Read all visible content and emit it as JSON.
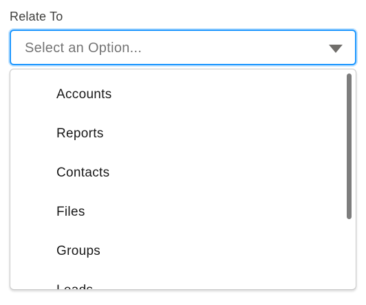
{
  "field": {
    "label": "Relate To",
    "placeholder": "Select an Option..."
  },
  "dropdown": {
    "options": [
      {
        "label": "Accounts"
      },
      {
        "label": "Reports"
      },
      {
        "label": "Contacts"
      },
      {
        "label": "Files"
      },
      {
        "label": "Groups"
      },
      {
        "label": "Leads"
      }
    ]
  },
  "colors": {
    "focus_border": "#1b96ff",
    "placeholder_text": "#747474",
    "option_text": "#181818",
    "scrollbar": "#7d7d7d"
  },
  "icons": {
    "caret": "chevron-down-icon"
  }
}
